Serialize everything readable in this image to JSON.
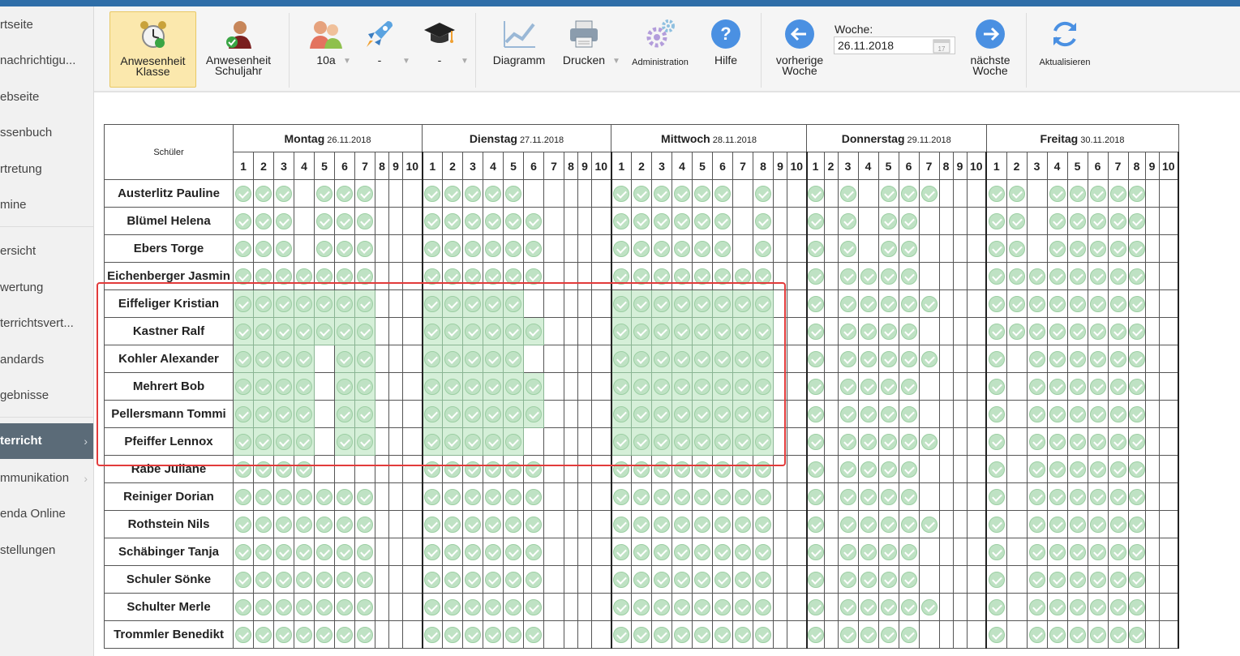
{
  "sidebar": {
    "items": [
      {
        "label": "rtseite"
      },
      {
        "label": "nachrichtigu..."
      },
      {
        "label": "ebseite"
      },
      {
        "label": "ssenbuch"
      },
      {
        "label": "rtretung"
      },
      {
        "label": "mine"
      },
      {
        "label": "ersicht"
      },
      {
        "label": "wertung"
      },
      {
        "label": "terrichtsvert..."
      },
      {
        "label": "andards"
      },
      {
        "label": "gebnisse"
      },
      {
        "label": "terricht",
        "active": true
      },
      {
        "label": "mmunikation"
      },
      {
        "label": "enda Online"
      },
      {
        "label": "stellungen"
      }
    ]
  },
  "toolbar": {
    "anwesenheit_klasse": "Anwesenheit Klasse",
    "anwesenheit_schuljahr": "Anwesenheit Schuljahr",
    "klasse_value": "10a",
    "fach_value": "-",
    "kurs_value": "-",
    "diagramm": "Diagramm",
    "drucken": "Drucken",
    "administration": "Administration",
    "hilfe": "Hilfe",
    "vorherige_woche": "vorherige Woche",
    "woche_label": "Woche:",
    "woche_value": "26.11.2018",
    "naechste_woche": "nächste Woche",
    "aktualisieren": "Aktualisieren",
    "calendar_day": "17"
  },
  "table": {
    "student_header": "Schüler",
    "periods": [
      "1",
      "2",
      "3",
      "4",
      "5",
      "6",
      "7",
      "8",
      "9",
      "10"
    ],
    "days": [
      {
        "name": "Montag",
        "date": "26.11.2018"
      },
      {
        "name": "Dienstag",
        "date": "27.11.2018"
      },
      {
        "name": "Mittwoch",
        "date": "28.11.2018"
      },
      {
        "name": "Donnerstag",
        "date": "29.11.2018"
      },
      {
        "name": "Freitag",
        "date": "30.11.2018"
      }
    ],
    "students": [
      {
        "name": "Austerlitz Pauline",
        "checks": [
          "1110111000",
          "1111100000",
          "1111110100",
          "1010111000",
          "1101111100"
        ]
      },
      {
        "name": "Blümel Helena",
        "checks": [
          "1110111000",
          "1111110000",
          "1111110100",
          "1010110000",
          "1101111100"
        ]
      },
      {
        "name": "Ebers Torge",
        "checks": [
          "1110111000",
          "1111110000",
          "1111110100",
          "1010110000",
          "1101111100"
        ]
      },
      {
        "name": "Eichenberger Jasmin",
        "checks": [
          "1111111000",
          "1111110000",
          "1111111100",
          "1011110000",
          "1111111100"
        ]
      },
      {
        "name": "Eiffeliger Kristian",
        "checks": [
          "1111111000",
          "1111100000",
          "1111111100",
          "1011111000",
          "1111111100"
        ]
      },
      {
        "name": "Kastner Ralf",
        "checks": [
          "1111111000",
          "1111110000",
          "1111111100",
          "1011110000",
          "1111111100"
        ]
      },
      {
        "name": "Kohler Alexander",
        "checks": [
          "1111011000",
          "1111100000",
          "1111111100",
          "1011111000",
          "1011111100"
        ]
      },
      {
        "name": "Mehrert Bob",
        "checks": [
          "1111011000",
          "1111110000",
          "1111111100",
          "1011110000",
          "1011111100"
        ]
      },
      {
        "name": "Pellersmann Tommi",
        "checks": [
          "1111011000",
          "1111110000",
          "1111111100",
          "1011110000",
          "1011111100"
        ]
      },
      {
        "name": "Pfeiffer Lennox",
        "checks": [
          "1111011000",
          "1111100000",
          "1111111100",
          "1011111000",
          "1011111100"
        ]
      },
      {
        "name": "Rabe Juliane",
        "checks": [
          "1111000000",
          "1111110000",
          "1111111100",
          "1011110000",
          "1011111100"
        ]
      },
      {
        "name": "Reiniger Dorian",
        "checks": [
          "1111111000",
          "1111110000",
          "1111111100",
          "1011110000",
          "1011111100"
        ]
      },
      {
        "name": "Rothstein Nils",
        "checks": [
          "1111111000",
          "1111110000",
          "1111111100",
          "1011111000",
          "1011111100"
        ]
      },
      {
        "name": "Schäbinger Tanja",
        "checks": [
          "1111111000",
          "1111110000",
          "1111111100",
          "1011110000",
          "1011111100"
        ]
      },
      {
        "name": "Schuler Sönke",
        "checks": [
          "1111111000",
          "1111110000",
          "1111111100",
          "1011110000",
          "1011111100"
        ]
      },
      {
        "name": "Schulter Merle",
        "checks": [
          "1111111000",
          "1111110000",
          "1111111100",
          "1011111000",
          "1011111100"
        ]
      },
      {
        "name": "Trommler Benedikt",
        "checks": [
          "1111111000",
          "1111110000",
          "1111111100",
          "1011110000",
          "1011111100"
        ]
      }
    ],
    "highlight_students": [
      "Eiffeliger Kristian",
      "Kastner Ralf",
      "Kohler Alexander",
      "Mehrert Bob",
      "Pellersmann Tommi",
      "Pfeiffer Lennox"
    ]
  },
  "colors": {
    "accent": "#2f6ea8",
    "check": "#bfe2c4",
    "shade": "#d5efd8",
    "highlight": "#e23b3b",
    "active_button": "#fbe8ad"
  }
}
